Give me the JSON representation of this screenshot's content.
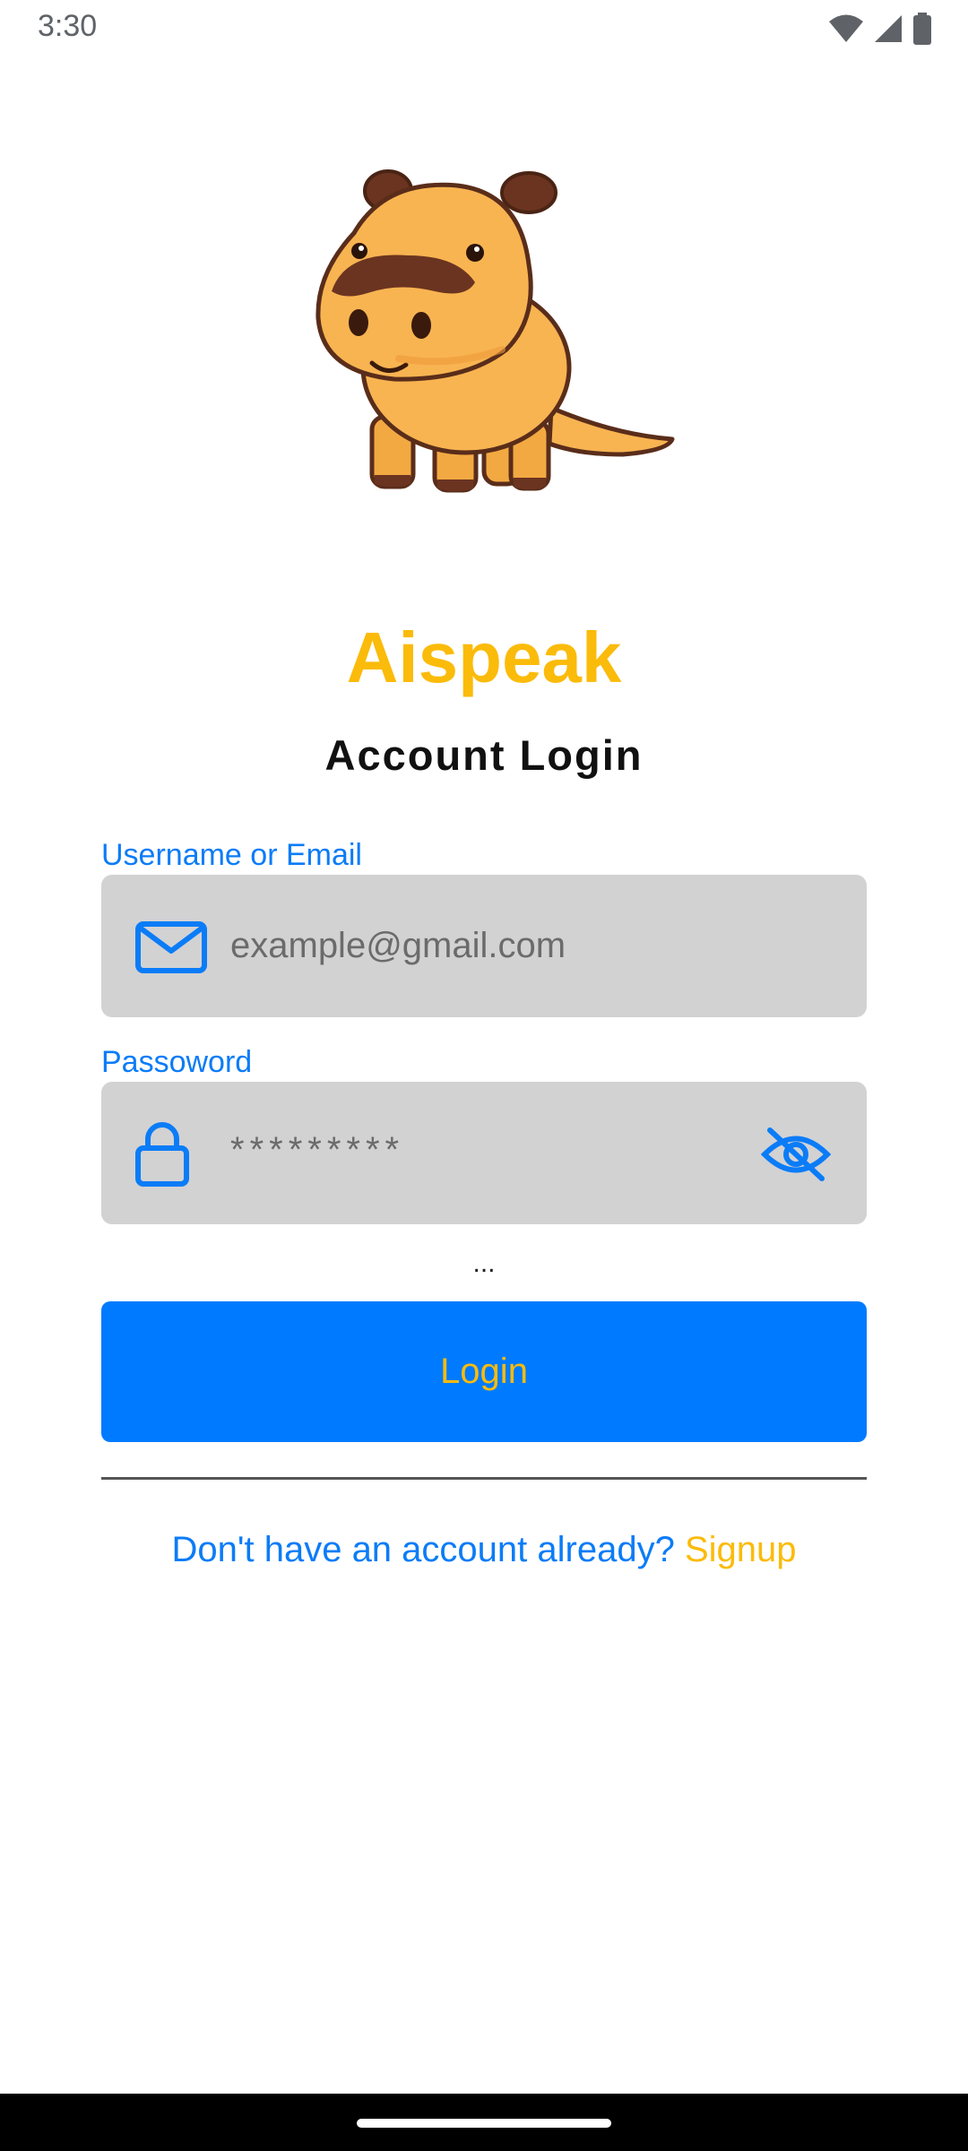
{
  "status_bar": {
    "time": "3:30",
    "icons": [
      "wifi-icon",
      "signal-icon",
      "battery-icon"
    ]
  },
  "app": {
    "name": "Aispeak",
    "mascot": "cartoon-hippo-mascot"
  },
  "login": {
    "title": "Account Login",
    "username_label": "Username or Email",
    "username_placeholder": "example@gmail.com",
    "username_icon": "mail-icon",
    "password_label": "Passoword",
    "password_value": "*********",
    "password_icon": "lock-icon",
    "visibility_icon": "eye-off-icon",
    "loading_indicator": "...",
    "button_label": "Login",
    "signup_prompt": "Don't have an account already?",
    "signup_link": "Signup"
  },
  "colors": {
    "accent_blue": "#007bff",
    "brand_yellow": "#fbbb0a",
    "field_bg": "#d2d2d3"
  }
}
